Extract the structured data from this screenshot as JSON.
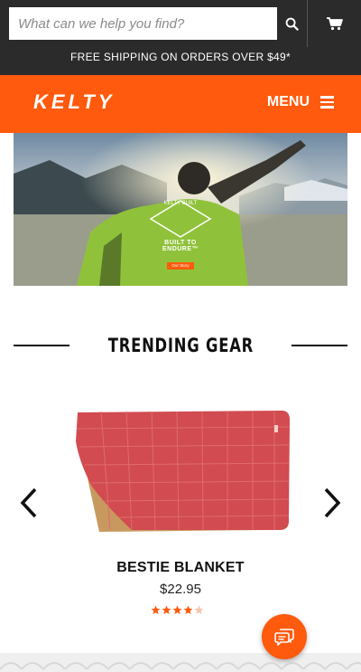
{
  "search": {
    "placeholder": "What can we help you find?"
  },
  "promo_text": "FREE SHIPPING ON ORDERS OVER $49*",
  "brand": {
    "logo_text": "KELTY",
    "menu_label": "MENU",
    "accent_color": "#ff5a0d"
  },
  "hero": {
    "badge_text": "KELTY BUILT",
    "tagline": "BUILT TO ENDURE™",
    "cta_label": "Our Story"
  },
  "section": {
    "title": "TRENDING GEAR"
  },
  "product": {
    "name": "BESTIE BLANKET",
    "price": "$22.95",
    "rating": 4,
    "rating_max": 5
  },
  "icons": [
    "search-icon",
    "cart-icon",
    "hamburger-icon",
    "chevron-left-icon",
    "chevron-right-icon",
    "star-icon",
    "chat-icon"
  ]
}
